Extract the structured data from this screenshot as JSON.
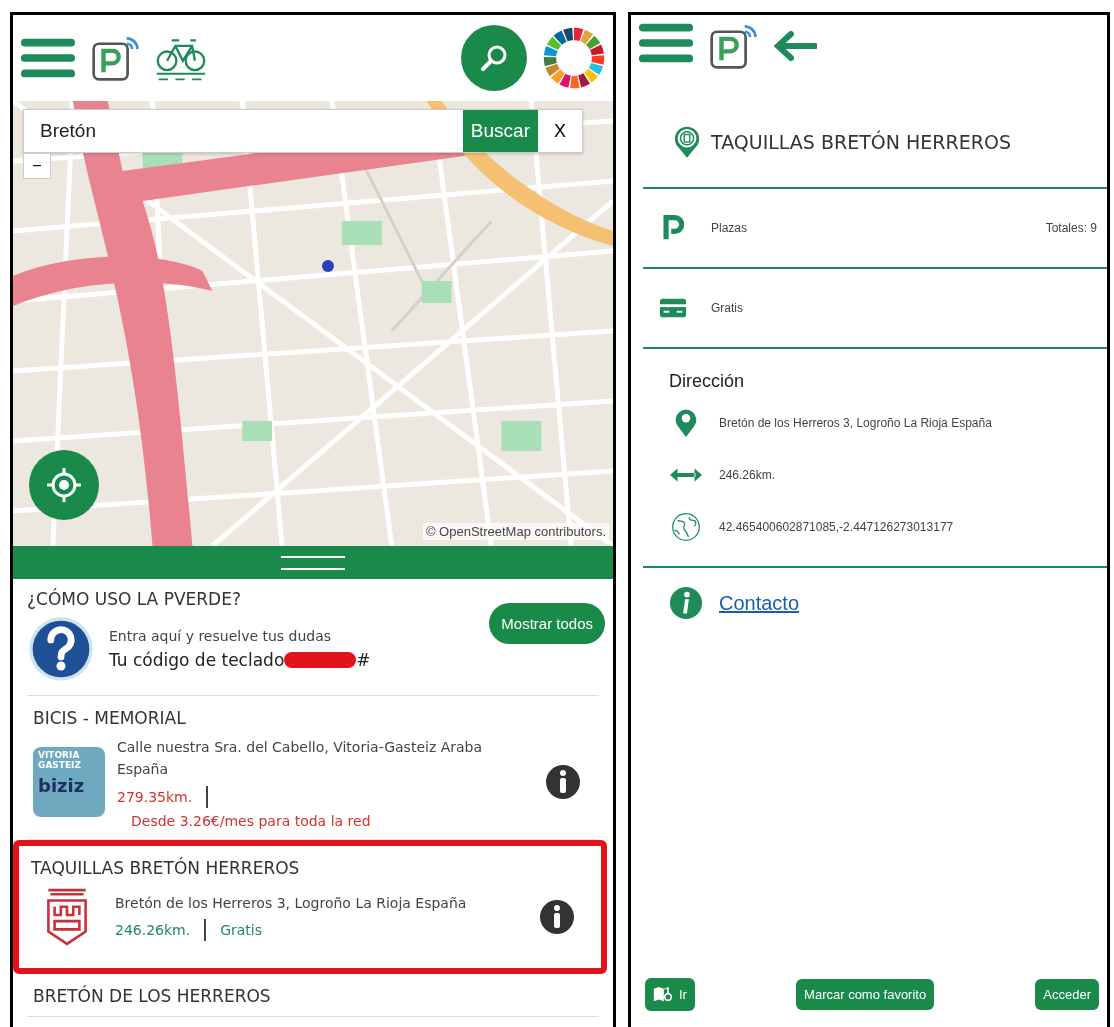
{
  "left": {
    "search": {
      "value": "Bretón",
      "button": "Buscar",
      "clear": "X"
    },
    "map": {
      "zoom_out": "−",
      "attribution": "© OpenStreetMap contributors."
    },
    "help": {
      "title": "¿CÓMO USO LA PVERDE?",
      "button": "Mostrar todos",
      "line1": "Entra aquí y resuelve tus dudas",
      "code_label": "Tu código de teclado",
      "code_suffix": "#"
    },
    "results": [
      {
        "name": "BICIS - MEMORIAL",
        "logo": {
          "kind": "bike-share",
          "lines": [
            "VITORIA",
            "GASTEIZ"
          ],
          "brand": "biziz"
        },
        "address": "Calle nuestra Sra. del Cabello, Vitoria-Gasteiz Araba España",
        "distance": "279.35km.",
        "price": "Desde 3.26€/mes para toda la red",
        "color": "#d0332f",
        "circled": false
      },
      {
        "name": "TAQUILLAS BRETÓN HERREROS",
        "logo": {
          "kind": "crest"
        },
        "address": "Bretón de los Herreros 3, Logroño La Rioja España",
        "distance": "246.26km.",
        "price": "Gratis",
        "color": "#1f8a5a",
        "circled": true
      },
      {
        "name": "BRETÓN DE LOS HERREROS"
      }
    ]
  },
  "right": {
    "title": "TAQUILLAS BRETÓN HERREROS",
    "rows": [
      {
        "kind": "parking",
        "label": "Plazas",
        "value": "Totales: 9"
      },
      {
        "kind": "price",
        "label": "Gratis"
      }
    ],
    "address_heading": "Dirección",
    "address_rows": [
      {
        "kind": "pin",
        "text": "Bretón de los Herreros 3, Logroño La Rioja España"
      },
      {
        "kind": "distance",
        "text": "246.26km."
      },
      {
        "kind": "globe",
        "text": "42.465400602871085,-2.447126273013177"
      }
    ],
    "contact": "Contacto",
    "actions": [
      {
        "kind": "directions",
        "label": "Ir"
      },
      {
        "kind": "plain",
        "label": "Marcar como favorito"
      },
      {
        "kind": "plain",
        "label": "Acceder"
      }
    ]
  }
}
